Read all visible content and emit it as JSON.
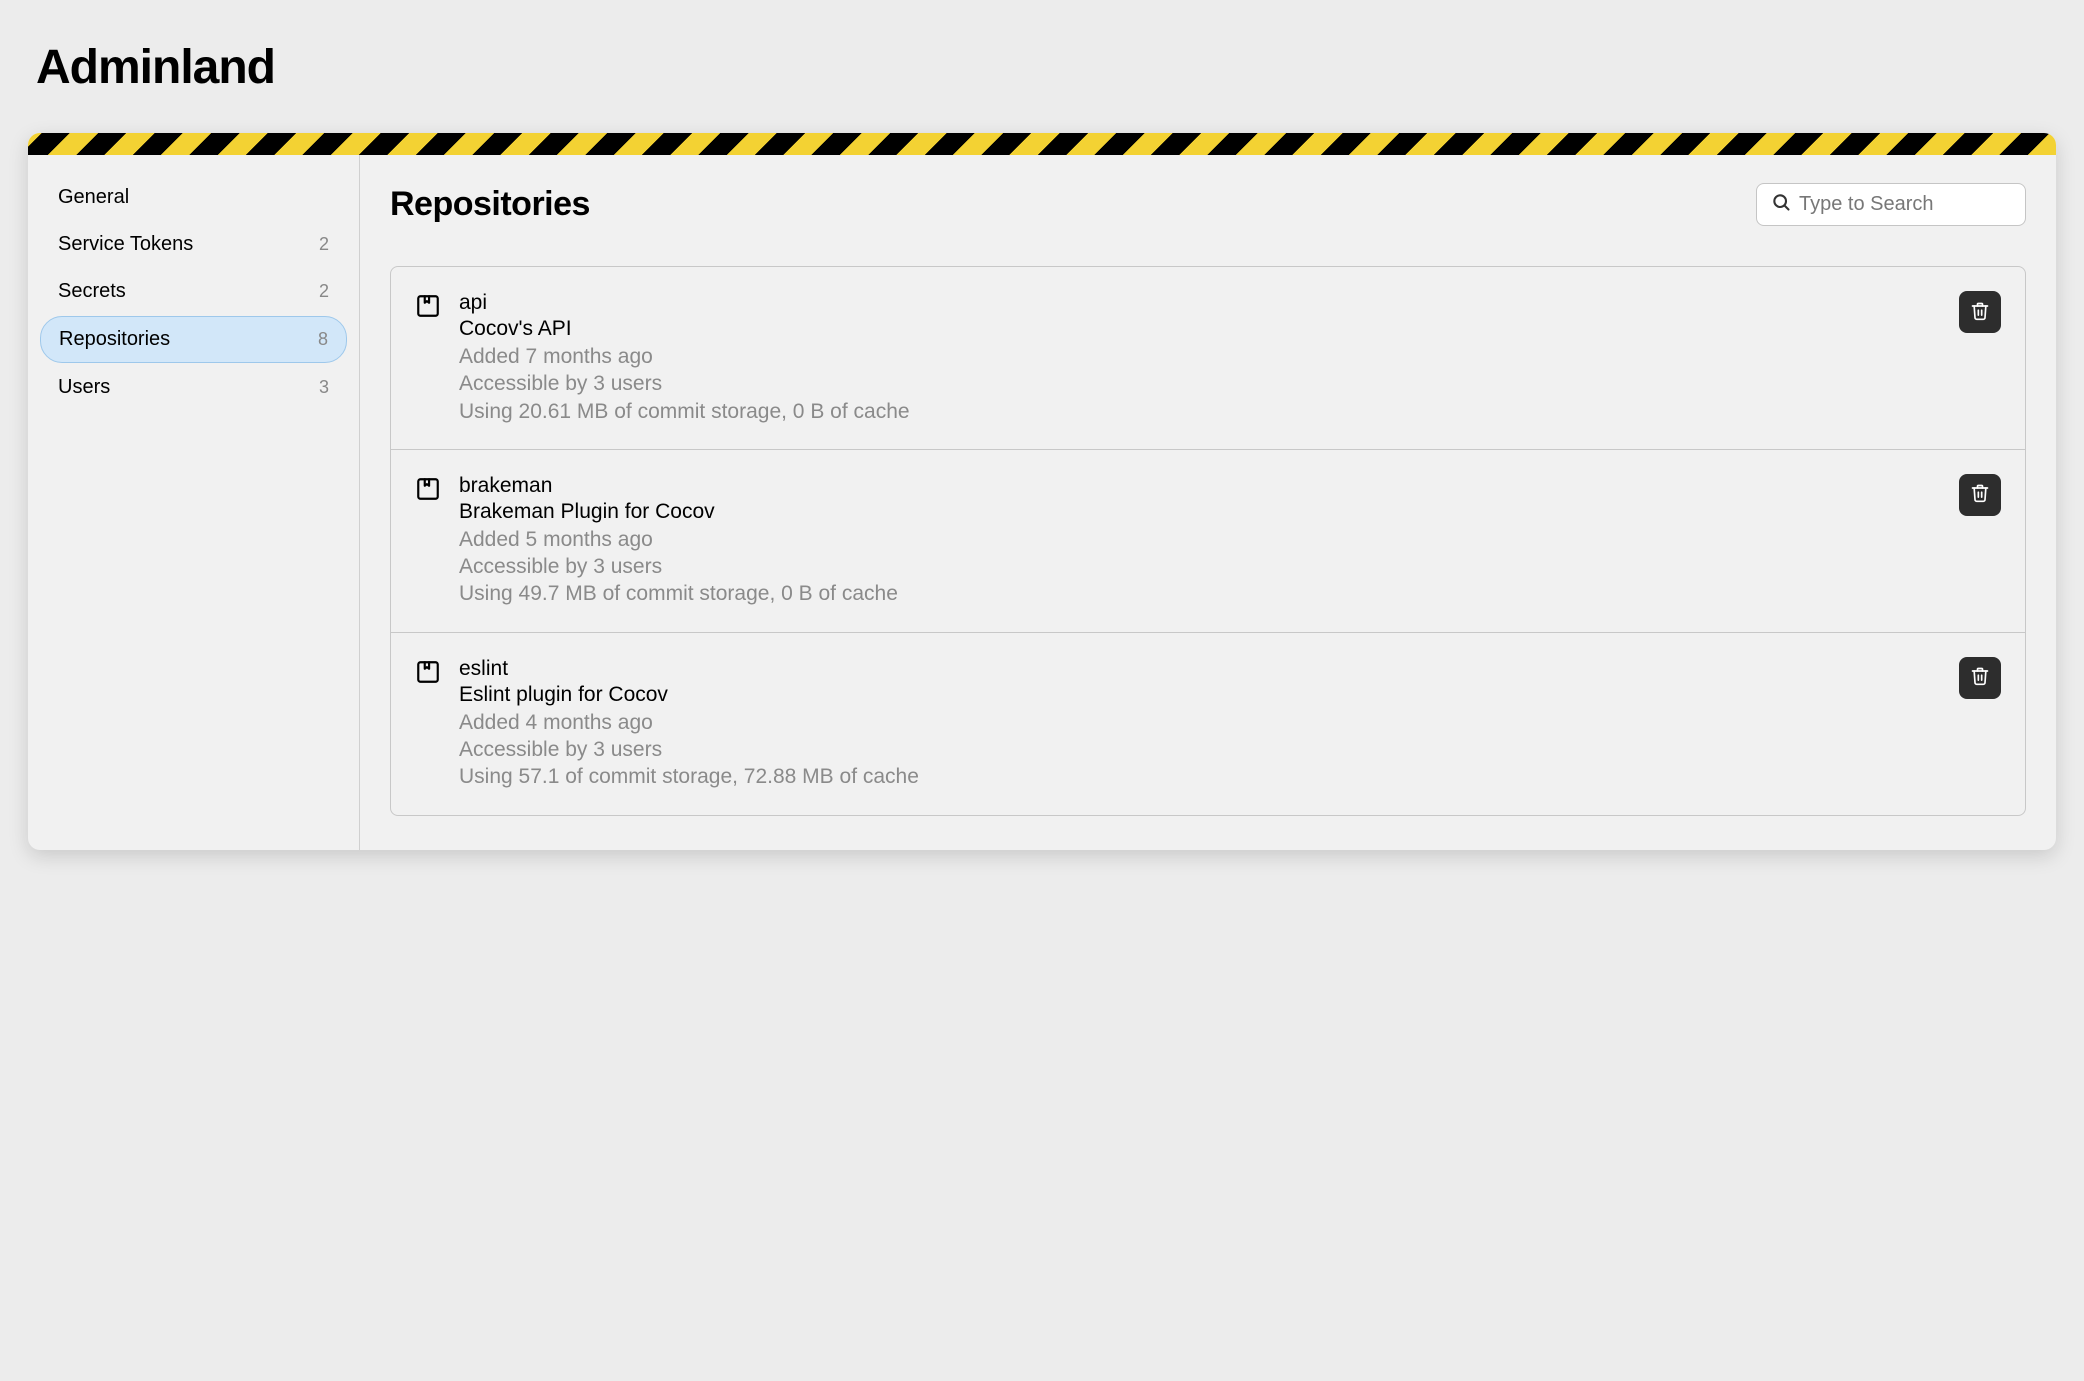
{
  "pageTitle": "Adminland",
  "sidebar": {
    "items": [
      {
        "label": "General",
        "count": ""
      },
      {
        "label": "Service Tokens",
        "count": "2"
      },
      {
        "label": "Secrets",
        "count": "2"
      },
      {
        "label": "Repositories",
        "count": "8"
      },
      {
        "label": "Users",
        "count": "3"
      }
    ]
  },
  "main": {
    "title": "Repositories",
    "searchPlaceholder": "Type to Search"
  },
  "repos": [
    {
      "name": "api",
      "description": "Cocov's API",
      "added": "Added 7 months ago",
      "access": "Accessible by 3 users",
      "storage": "Using 20.61 MB of commit storage, 0 B of cache"
    },
    {
      "name": "brakeman",
      "description": "Brakeman Plugin for Cocov",
      "added": "Added 5 months ago",
      "access": "Accessible by 3 users",
      "storage": "Using 49.7 MB of commit storage, 0 B of cache"
    },
    {
      "name": "eslint",
      "description": "Eslint plugin for Cocov",
      "added": "Added 4 months ago",
      "access": "Accessible by 3 users",
      "storage": "Using 57.1 of commit storage, 72.88 MB of cache"
    }
  ]
}
